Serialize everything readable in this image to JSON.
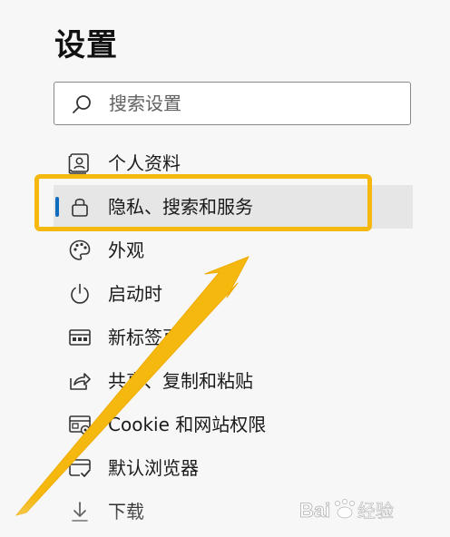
{
  "page": {
    "title": "设置"
  },
  "search": {
    "placeholder": "搜索设置",
    "value": ""
  },
  "nav": {
    "items": [
      {
        "label": "个人资料",
        "icon": "profile-icon"
      },
      {
        "label": "隐私、搜索和服务",
        "icon": "lock-icon",
        "selected": true
      },
      {
        "label": "外观",
        "icon": "palette-icon"
      },
      {
        "label": "启动时",
        "icon": "power-icon"
      },
      {
        "label": "新标签页",
        "icon": "new-tab-icon"
      },
      {
        "label": "共享、复制和粘贴",
        "icon": "share-icon"
      },
      {
        "label": "Cookie 和网站权限",
        "icon": "site-permissions-icon"
      },
      {
        "label": "默认浏览器",
        "icon": "default-browser-icon"
      },
      {
        "label": "下载",
        "icon": "download-icon"
      }
    ]
  },
  "annotation": {
    "highlight_color": "#f5b80f",
    "arrow_color": "#f5b80f"
  },
  "colors": {
    "accent": "#0f6cbd",
    "background": "#f7f7f7",
    "selected_background": "#e6e6e6"
  },
  "watermark": {
    "brand": "Baidu",
    "product": "经验"
  }
}
